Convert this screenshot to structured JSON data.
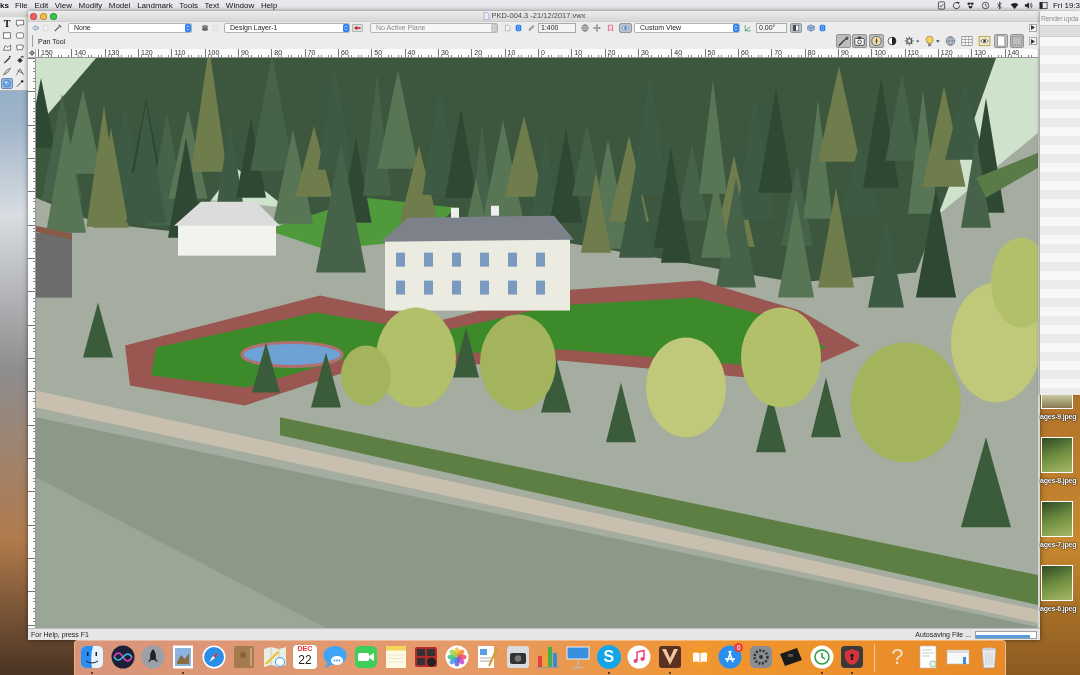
{
  "menu_bar": {
    "items": [
      "ks",
      "File",
      "Edit",
      "View",
      "Modify",
      "Model",
      "Landmark",
      "Tools",
      "Text",
      "Window",
      "Help"
    ],
    "clock": "Fri 19:3"
  },
  "tool_palette": {
    "tools": [
      {
        "kind": "glyph",
        "label": "T",
        "selected": false
      },
      {
        "kind": "icon",
        "selected": false
      },
      {
        "kind": "icon",
        "selected": false
      },
      {
        "kind": "icon",
        "selected": false
      },
      {
        "kind": "icon",
        "selected": false
      },
      {
        "kind": "icon",
        "selected": false
      },
      {
        "kind": "icon",
        "selected": false
      },
      {
        "kind": "icon",
        "selected": false
      },
      {
        "kind": "icon",
        "selected": false
      },
      {
        "kind": "icon",
        "selected": false
      },
      {
        "kind": "icon",
        "selected": true
      },
      {
        "kind": "icon",
        "selected": false
      }
    ]
  },
  "window": {
    "title": "PKD-004.3 -21/12/2017.vwx",
    "toolbar": [
      {
        "kind": "button",
        "on": false,
        "disabled": false
      },
      {
        "kind": "button",
        "on": false,
        "disabled": true
      },
      {
        "kind": "button",
        "on": false,
        "disabled": false
      },
      {
        "kind": "menu",
        "value": "None",
        "disabled": false
      },
      {
        "kind": "button",
        "on": false,
        "disabled": false
      },
      {
        "kind": "button",
        "on": false,
        "disabled": true
      },
      {
        "kind": "menu",
        "value": "Design Layer-1",
        "disabled": false
      },
      {
        "kind": "button",
        "on": false,
        "disabled": false
      },
      {
        "kind": "menu",
        "value": "No Active Plane",
        "disabled": true
      },
      {
        "kind": "button",
        "on": false,
        "disabled": false
      },
      {
        "kind": "button",
        "on": false,
        "disabled": false
      },
      {
        "kind": "button",
        "on": false,
        "disabled": false
      },
      {
        "kind": "field",
        "value": "1:400"
      },
      {
        "kind": "button",
        "on": false,
        "disabled": false
      },
      {
        "kind": "button",
        "on": false,
        "disabled": false
      },
      {
        "kind": "button",
        "on": false,
        "disabled": false
      },
      {
        "kind": "button",
        "on": true,
        "disabled": false
      },
      {
        "kind": "menu",
        "value": "Custom View",
        "disabled": false
      },
      {
        "kind": "button",
        "on": false,
        "disabled": false
      },
      {
        "kind": "field",
        "value": "0.00°"
      },
      {
        "kind": "button",
        "on": true,
        "disabled": false
      },
      {
        "kind": "button",
        "on": false,
        "disabled": false
      },
      {
        "kind": "button",
        "on": false,
        "disabled": false
      }
    ],
    "mode_bar": {
      "tool_name": "Pan Tool",
      "view_buttons": [
        {
          "on": true
        },
        {
          "on": true
        },
        {
          "on": true
        },
        {
          "on": false
        },
        {
          "on": false
        },
        {
          "on": false
        },
        {
          "on": false
        },
        {
          "on": false
        },
        {
          "on": false
        },
        {
          "on": true
        },
        {
          "on": true
        }
      ]
    },
    "ruler": {
      "labels": [
        "150",
        "140",
        "130",
        "120",
        "110",
        "100",
        "90",
        "80",
        "70",
        "60",
        "50",
        "40",
        "30",
        "20",
        "10",
        "0",
        "10",
        "20",
        "30",
        "40",
        "50",
        "60",
        "70",
        "80",
        "90",
        "100",
        "110",
        "120",
        "130",
        "140"
      ]
    },
    "status_bar": {
      "help": "For Help, press F1",
      "task": "Autosaving File ...",
      "progress": {
        "level": 0.9
      }
    }
  },
  "render_window": {
    "title": "Render upda"
  },
  "desktop_files": [
    {
      "name": "ages-9.jpeg"
    },
    {
      "name": "ages-8.jpeg"
    },
    {
      "name": "ages-7.jpeg"
    },
    {
      "name": "ages-6.jpeg"
    }
  ],
  "dock": {
    "apps": [
      {
        "kind": "icon",
        "running": true
      },
      {
        "kind": "icon",
        "running": false
      },
      {
        "kind": "icon",
        "running": false
      },
      {
        "kind": "icon",
        "running": true
      },
      {
        "kind": "icon",
        "running": false
      },
      {
        "kind": "icon",
        "running": false
      },
      {
        "kind": "icon",
        "running": false
      },
      {
        "kind": "calendar",
        "month": "DEC",
        "day": "22",
        "running": false
      },
      {
        "kind": "icon",
        "running": false
      },
      {
        "kind": "icon",
        "running": false
      },
      {
        "kind": "icon",
        "running": false
      },
      {
        "kind": "icon",
        "running": false
      },
      {
        "kind": "icon",
        "running": false
      },
      {
        "kind": "icon",
        "running": false
      },
      {
        "kind": "icon",
        "running": false
      },
      {
        "kind": "icon",
        "running": false
      },
      {
        "kind": "icon",
        "running": false
      },
      {
        "kind": "disc",
        "label": "S",
        "running": true
      },
      {
        "kind": "icon",
        "running": false
      },
      {
        "kind": "icon",
        "running": true
      },
      {
        "kind": "icon",
        "running": false
      },
      {
        "kind": "icon",
        "badge": "6",
        "running": false
      },
      {
        "kind": "icon",
        "running": false
      },
      {
        "kind": "icon",
        "running": false
      },
      {
        "kind": "icon",
        "running": true
      },
      {
        "kind": "icon",
        "running": true
      }
    ],
    "documents": [
      {
        "kind": "glyph",
        "label": "?"
      },
      {
        "kind": "icon"
      },
      {
        "kind": "icon"
      },
      {
        "kind": "icon"
      }
    ]
  }
}
